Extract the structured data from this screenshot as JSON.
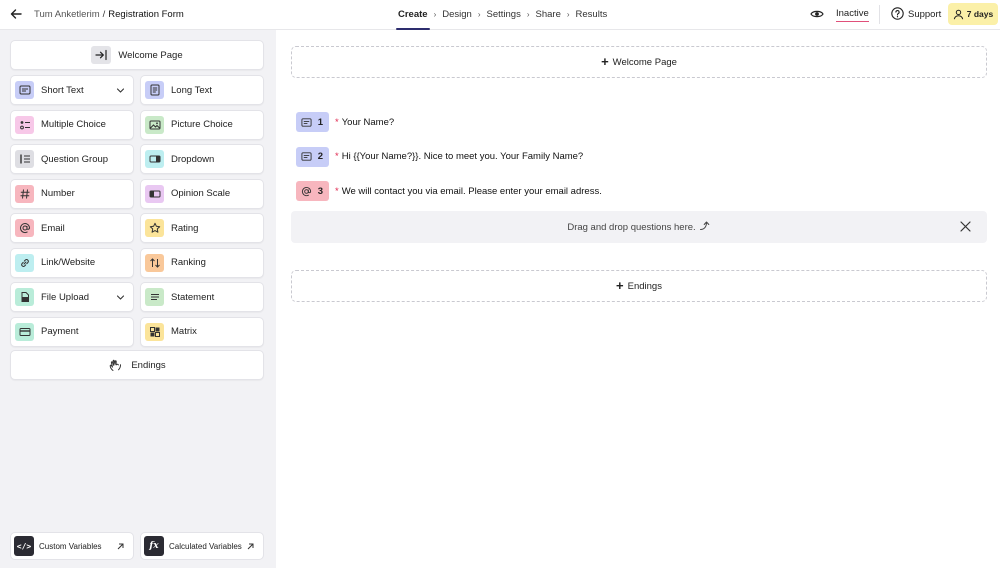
{
  "breadcrumb": {
    "parent": "Tum Anketlerim",
    "separator": "/",
    "current": "Registration Form"
  },
  "steps": [
    "Create",
    "Design",
    "Settings",
    "Share",
    "Results"
  ],
  "active_step": "Create",
  "status": {
    "label": "Inactive",
    "underline_color": "#e0507a"
  },
  "support_label": "Support",
  "trial_label": "7 days",
  "sidebar": {
    "welcome_label": "Welcome Page",
    "tiles": [
      {
        "label": "Short Text",
        "icon": "short-text-icon",
        "color": "#c7cdf7",
        "dropdown": true
      },
      {
        "label": "Long Text",
        "icon": "long-text-icon",
        "color": "#c7cdf7"
      },
      {
        "label": "Multiple Choice",
        "icon": "multiple-choice-icon",
        "color": "#f7c8e8"
      },
      {
        "label": "Picture Choice",
        "icon": "picture-icon",
        "color": "#c9e9c8"
      },
      {
        "label": "Question Group",
        "icon": "question-group-icon",
        "color": "#dedee3"
      },
      {
        "label": "Dropdown",
        "icon": "dropdown-icon",
        "color": "#bdeef0"
      },
      {
        "label": "Number",
        "icon": "hash-icon",
        "color": "#f7b6be"
      },
      {
        "label": "Opinion Scale",
        "icon": "opinion-scale-icon",
        "color": "#e9c8f2"
      },
      {
        "label": "Email",
        "icon": "at-icon",
        "color": "#f7b6be"
      },
      {
        "label": "Rating",
        "icon": "star-icon",
        "color": "#fbe49a"
      },
      {
        "label": "Link/Website",
        "icon": "link-icon",
        "color": "#bdeef0"
      },
      {
        "label": "Ranking",
        "icon": "ranking-icon",
        "color": "#f9c89a"
      },
      {
        "label": "File Upload",
        "icon": "file-upload-icon",
        "color": "#b9ecd9",
        "dropdown": true
      },
      {
        "label": "Statement",
        "icon": "statement-icon",
        "color": "#c9e9c8"
      },
      {
        "label": "Payment",
        "icon": "card-icon",
        "color": "#b9ecd9"
      },
      {
        "label": "Matrix",
        "icon": "matrix-icon",
        "color": "#fbe49a"
      }
    ],
    "endings_label": "Endings",
    "custom_variables_label": "Custom Variables",
    "calculated_variables_label": "Calculated Variables"
  },
  "main": {
    "welcome_label": "Welcome Page",
    "questions": [
      {
        "number": "1",
        "icon": "short-text-icon",
        "color": "#c7cdf7",
        "required": "*",
        "text": "Your Name?"
      },
      {
        "number": "2",
        "icon": "short-text-icon",
        "color": "#c7cdf7",
        "required": "*",
        "text": "Hi {{Your Name?}}. Nice to meet you. Your Family Name?"
      },
      {
        "number": "3",
        "icon": "at-icon",
        "color": "#f7b6be",
        "required": "*",
        "text": "We will contact you via email. Please enter your email adress."
      }
    ],
    "drop_text": "Drag and drop questions here.",
    "endings_label": "Endings"
  }
}
